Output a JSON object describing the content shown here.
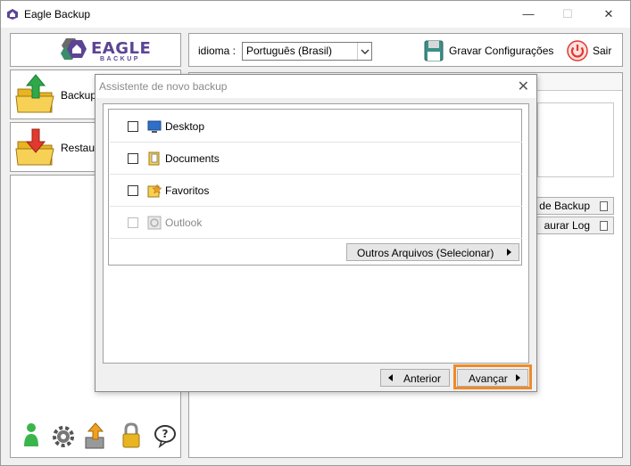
{
  "window": {
    "title": "Eagle Backup",
    "controls": {
      "minimize": "—",
      "maximize": "☐",
      "close": "✕"
    }
  },
  "logo": {
    "name": "EAGLE",
    "sub": "BACKUP",
    "color": "#5c4494"
  },
  "sidebar": {
    "items": [
      {
        "label": "Backup",
        "icon": "folder-upload-icon"
      },
      {
        "label": "Restau",
        "icon": "folder-download-icon"
      }
    ],
    "bottom_icons": [
      "user-icon",
      "gear-icon",
      "export-icon",
      "lock-icon",
      "help-icon"
    ]
  },
  "topbar": {
    "language_label": "idioma :",
    "language_value": "Português (Brasil)",
    "save_label": "Gravar Configurações",
    "exit_label": "Sair"
  },
  "main": {
    "buttons": [
      {
        "label": "de Backup"
      },
      {
        "label": "aurar Log"
      }
    ]
  },
  "dialog": {
    "title": "Assistente de novo backup",
    "close": "✕",
    "folders": [
      {
        "label": "Desktop",
        "icon": "desktop-icon",
        "checked": false,
        "enabled": true
      },
      {
        "label": "Documents",
        "icon": "documents-icon",
        "checked": false,
        "enabled": true
      },
      {
        "label": "Favoritos",
        "icon": "favorites-icon",
        "checked": false,
        "enabled": true
      },
      {
        "label": "Outlook",
        "icon": "outlook-icon",
        "checked": false,
        "enabled": false
      }
    ],
    "other_files_label": "Outros Arquivos (Selecionar)",
    "back_label": "Anterior",
    "next_label": "Avançar",
    "highlight_color": "#f08a28"
  }
}
